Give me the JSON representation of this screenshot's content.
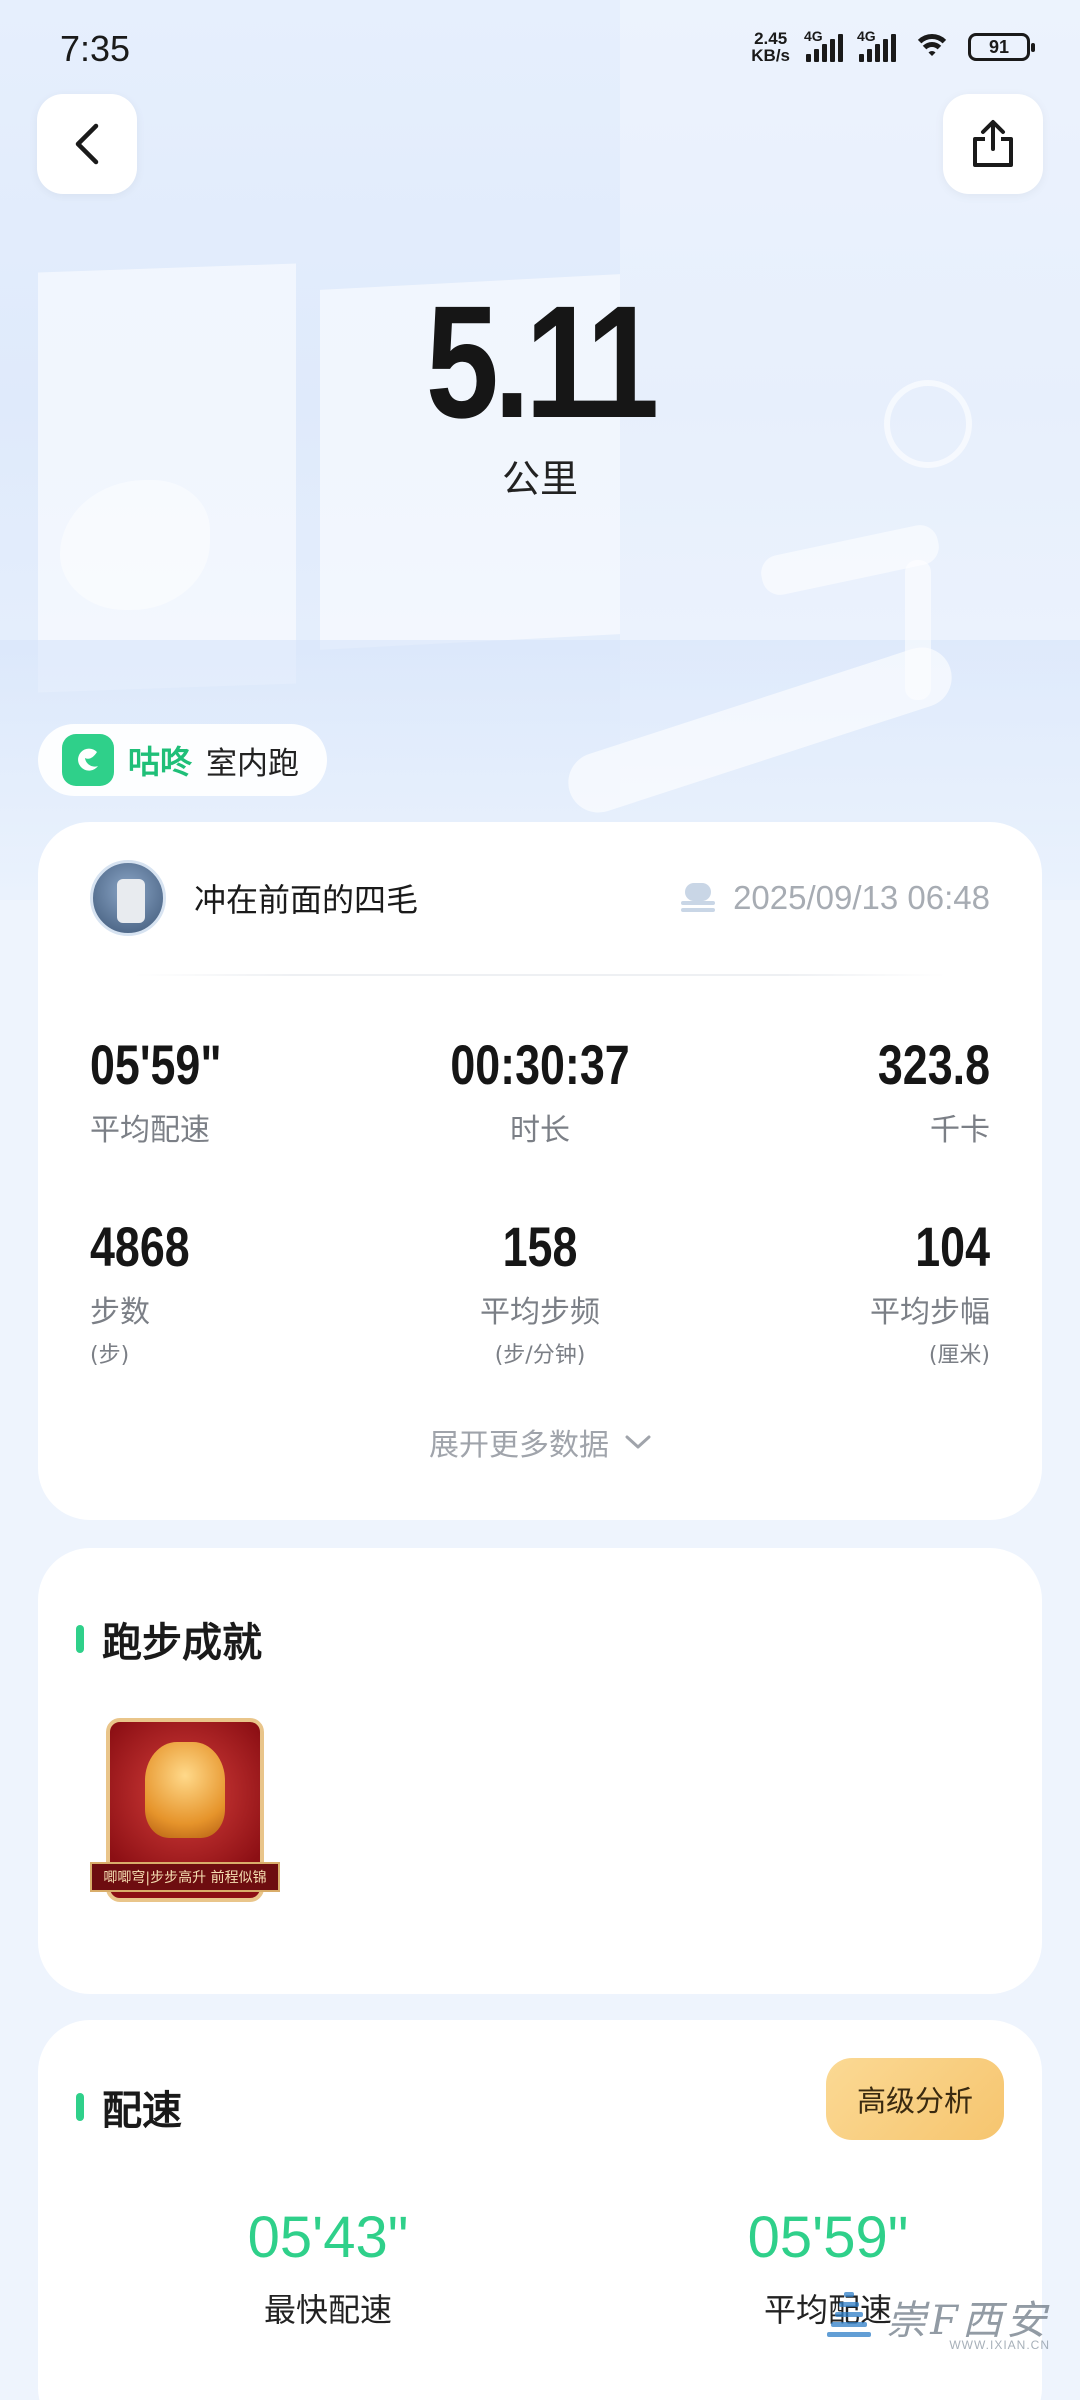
{
  "status_bar": {
    "time": "7:35",
    "net_speed_value": "2.45",
    "net_speed_unit": "KB/s",
    "signal1_label": "4G",
    "signal2_label": "4G",
    "battery": "91"
  },
  "hero": {
    "distance": "5.11",
    "distance_unit": "公里"
  },
  "source": {
    "brand": "咕咚",
    "type": "室内跑"
  },
  "user": {
    "name": "冲在前面的四毛",
    "datetime": "2025/09/13 06:48",
    "weather_icon": "cloud-icon"
  },
  "stats": [
    {
      "value": "05'59\"",
      "label": "平均配速",
      "sub": ""
    },
    {
      "value": "00:30:37",
      "label": "时长",
      "sub": ""
    },
    {
      "value": "323.8",
      "label": "千卡",
      "sub": ""
    },
    {
      "value": "4868",
      "label": "步数",
      "sub": "(步)"
    },
    {
      "value": "158",
      "label": "平均步频",
      "sub": "(步/分钟)"
    },
    {
      "value": "104",
      "label": "平均步幅",
      "sub": "(厘米)"
    }
  ],
  "expand_label": "展开更多数据",
  "achievements": {
    "title": "跑步成就",
    "medal_text": "唧唧穹|步步高升 前程似锦"
  },
  "pace": {
    "title": "配速",
    "advanced_button": "高级分析",
    "fastest_value": "05'43\"",
    "fastest_label": "最快配速",
    "average_value": "05'59\"",
    "average_label": "平均配速"
  },
  "watermark": {
    "text": "崇Ϝ西安",
    "sub": "WWW.IXIAN.CN"
  },
  "colors": {
    "accent_green": "#2fd08a",
    "advanced_gold": "#f6c56f"
  }
}
